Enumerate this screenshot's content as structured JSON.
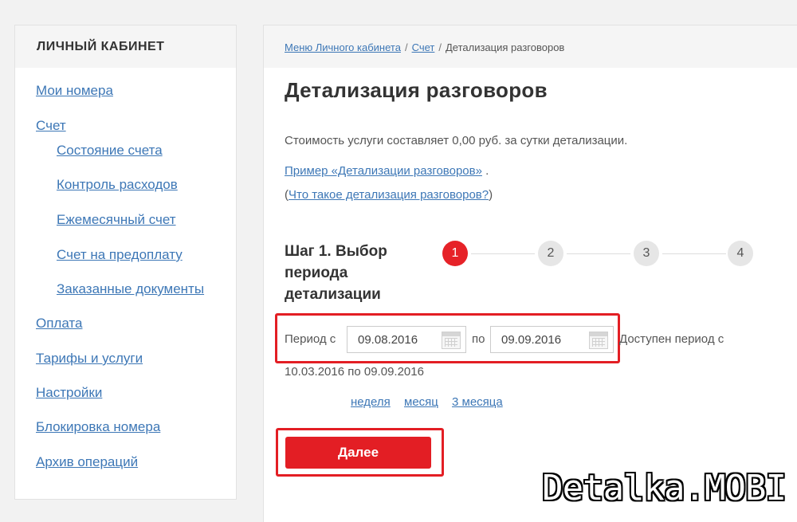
{
  "sidebar": {
    "title": "ЛИЧНЫЙ КАБИНЕТ",
    "items": [
      {
        "label": "Мои номера"
      },
      {
        "label": "Счет"
      },
      {
        "label": "Состояние счета"
      },
      {
        "label": "Контроль расходов"
      },
      {
        "label": "Ежемесячный счет"
      },
      {
        "label": "Счет на предоплату"
      },
      {
        "label": "Заказанные документы"
      },
      {
        "label": "Оплата"
      },
      {
        "label": "Тарифы и услуги"
      },
      {
        "label": "Настройки"
      },
      {
        "label": "Блокировка номера"
      },
      {
        "label": "Архив операций"
      }
    ]
  },
  "breadcrumb": {
    "items": [
      "Меню Личного кабинета",
      "Счет"
    ],
    "current": "Детализация разговоров",
    "separator": "/"
  },
  "main": {
    "title": "Детализация разговоров",
    "cost_text": "Стоимость услуги составляет 0,00 руб. за сутки детализации.",
    "example_link": "Пример «Детализации разговоров»",
    "example_suffix": ".",
    "whatis_prefix": "(",
    "whatis_link": "Что такое детализация разговоров?",
    "whatis_suffix": ")"
  },
  "step": {
    "title": "Шаг 1. Выбор периода детализации",
    "steps": [
      "1",
      "2",
      "3",
      "4"
    ],
    "active_step": 1
  },
  "period": {
    "from_label": "Период с",
    "from_value": "09.08.2016",
    "to_label": "по",
    "to_value": "09.09.2016",
    "available_line1": "Доступен период с",
    "available_line2": "10.03.2016 по 09.09.2016",
    "quick": [
      "неделя",
      "месяц",
      "3 месяца"
    ]
  },
  "next_button": "Далее",
  "watermark": "Detalka.MOBI",
  "colors": {
    "accent": "#e31e24",
    "link": "#3d77b6",
    "highlight_border": "#e31e24"
  }
}
